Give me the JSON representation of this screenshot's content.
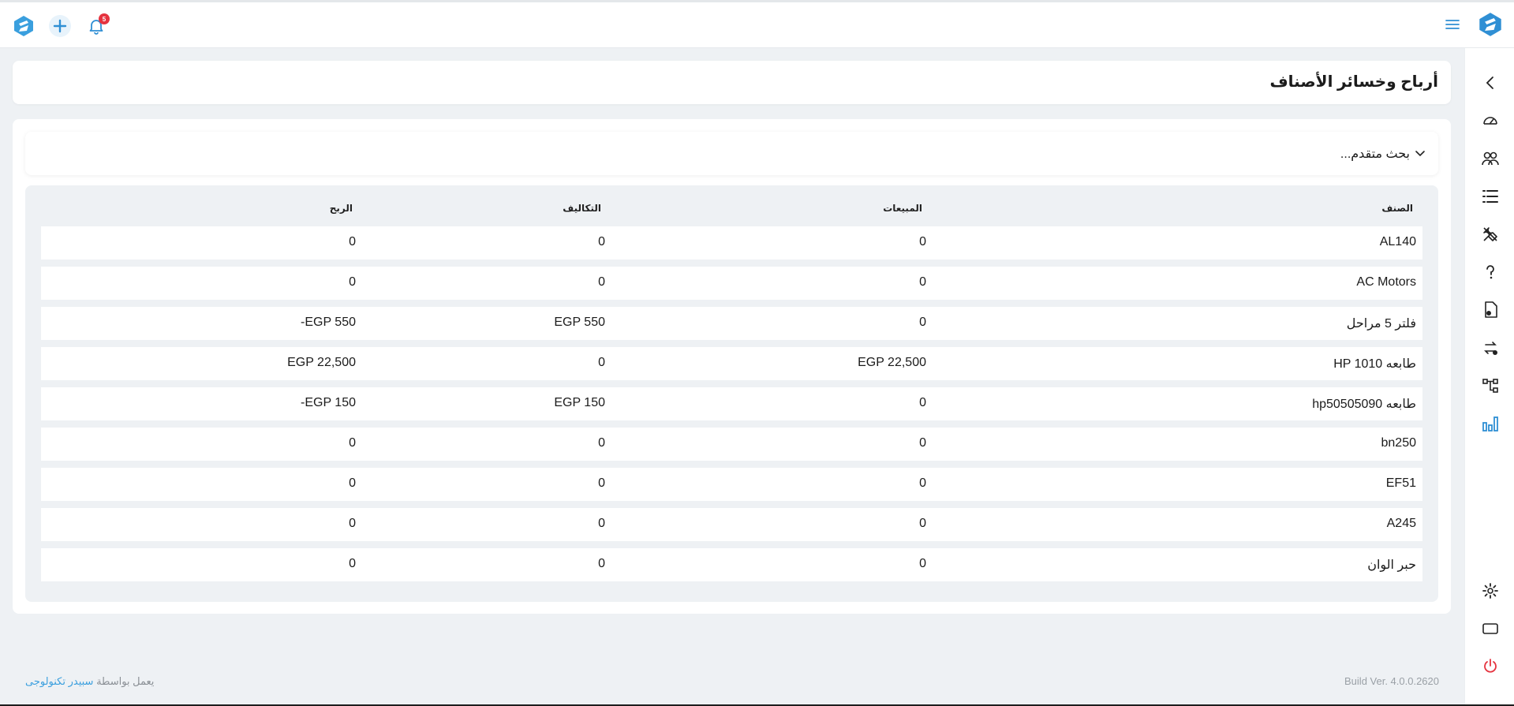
{
  "topbar": {
    "notification_count": "5",
    "brand_color": "#3a9fde"
  },
  "page": {
    "title": "أرباح وخسائر الأصناف"
  },
  "search": {
    "toggle_label": "بحث متقدم..."
  },
  "table": {
    "headers": {
      "item": "الصنف",
      "sales": "المبيعات",
      "costs": "التكاليف",
      "profit": "الربح"
    },
    "rows": [
      {
        "item": "AL140",
        "sales": "0",
        "costs": "0",
        "profit": "0"
      },
      {
        "item": "AC Motors",
        "sales": "0",
        "costs": "0",
        "profit": "0"
      },
      {
        "item": "فلتر 5 مراحل",
        "sales": "0",
        "costs": "EGP 550",
        "profit": "EGP 550-"
      },
      {
        "item": "طابعه HP 1010",
        "sales": "EGP 22,500",
        "costs": "0",
        "profit": "EGP 22,500"
      },
      {
        "item": "طابعه hp50505090",
        "sales": "0",
        "costs": "EGP 150",
        "profit": "EGP 150-"
      },
      {
        "item": "bn250",
        "sales": "0",
        "costs": "0",
        "profit": "0"
      },
      {
        "item": "EF51",
        "sales": "0",
        "costs": "0",
        "profit": "0"
      },
      {
        "item": "A245",
        "sales": "0",
        "costs": "0",
        "profit": "0"
      },
      {
        "item": "حبر الوان",
        "sales": "0",
        "costs": "0",
        "profit": "0"
      }
    ]
  },
  "footer": {
    "powered_prefix": "يعمل بواسطة",
    "powered_link": "سبيدر تكنولوجى",
    "build": "Build Ver. 4.0.0.2620"
  },
  "sidebar": {
    "items": [
      "collapse-arrow-icon",
      "dashboard-gauge-icon",
      "users-icon",
      "list-icon",
      "tools-icon",
      "help-icon",
      "document-icon",
      "transfer-icon",
      "hierarchy-icon",
      "reports-chart-icon"
    ],
    "bottom": [
      "settings-icon",
      "screen-icon",
      "power-icon"
    ]
  }
}
